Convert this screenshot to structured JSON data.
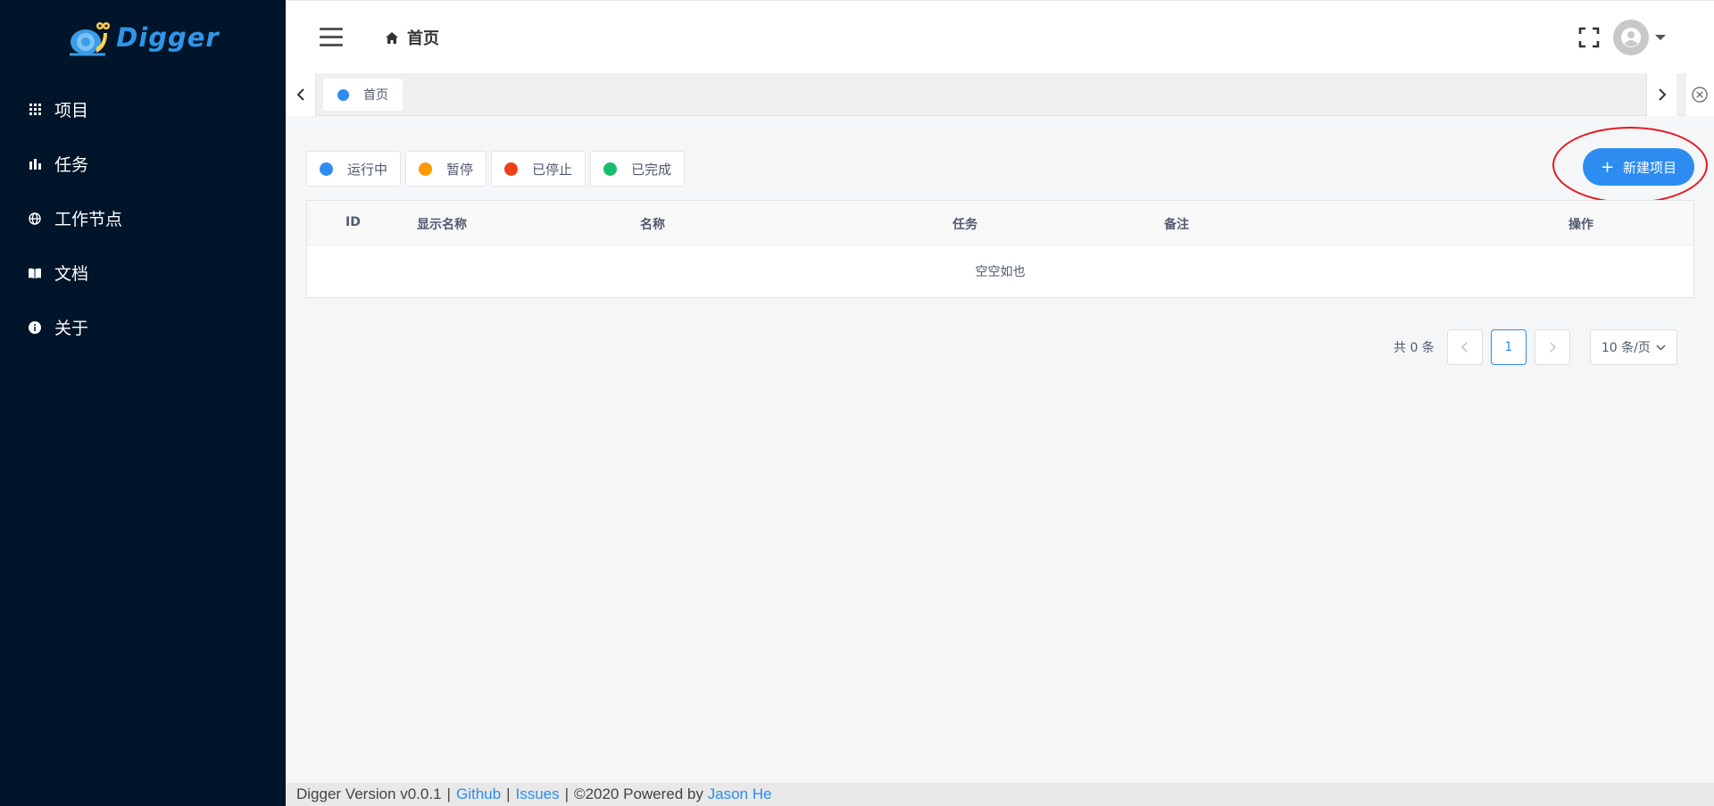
{
  "app": {
    "logo_text": "Digger",
    "accent_color": "#2d8cf0",
    "sidebar_color": "#001529"
  },
  "sidebar": {
    "items": [
      {
        "label": "项目",
        "icon": "grid-icon"
      },
      {
        "label": "任务",
        "icon": "bar-chart-icon"
      },
      {
        "label": "工作节点",
        "icon": "globe-icon"
      },
      {
        "label": "文档",
        "icon": "book-icon"
      },
      {
        "label": "关于",
        "icon": "info-icon"
      }
    ]
  },
  "header": {
    "breadcrumb": "首页"
  },
  "tabs": [
    {
      "label": "首页",
      "active": true
    }
  ],
  "filters": [
    {
      "label": "运行中",
      "color": "#2d8cf0"
    },
    {
      "label": "暂停",
      "color": "#ff9900"
    },
    {
      "label": "已停止",
      "color": "#ed4014"
    },
    {
      "label": "已完成",
      "color": "#19be6b"
    }
  ],
  "actions": {
    "new_project": "新建项目"
  },
  "table": {
    "columns": [
      "ID",
      "显示名称",
      "名称",
      "任务",
      "备注",
      "操作"
    ],
    "rows": [],
    "empty_text": "空空如也"
  },
  "pagination": {
    "total": "共 0 条",
    "current_page": "1",
    "page_size": "10 条/页"
  },
  "footer": {
    "version": "Digger Version v0.0.1",
    "sep": "|",
    "github": "Github",
    "issues": "Issues",
    "copyright": "©2020 Powered by",
    "author": "Jason He"
  }
}
